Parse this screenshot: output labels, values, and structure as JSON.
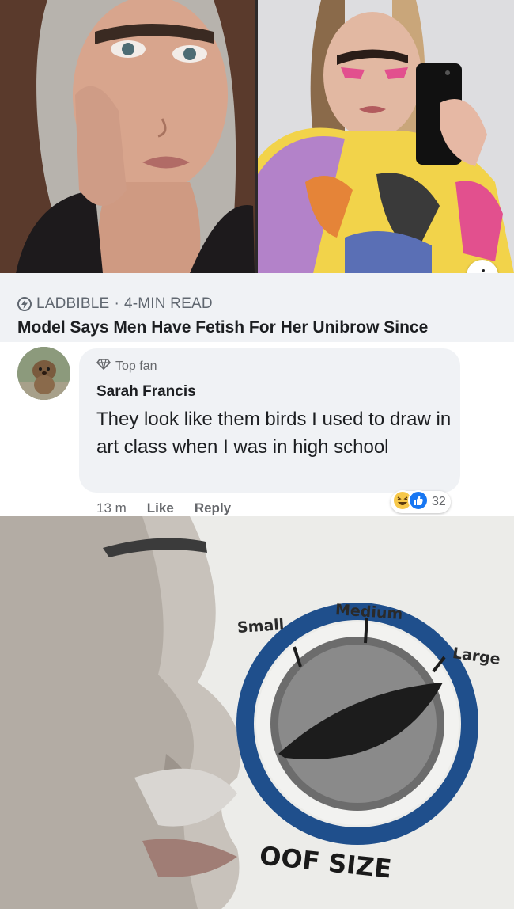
{
  "post": {
    "source": "LADBIBLE",
    "separator": "·",
    "read_time": "4-MIN READ",
    "headline": "Model Says Men Have Fetish For Her Unibrow Since",
    "info_glyph": "i"
  },
  "comment": {
    "badge": "Top fan",
    "author": "Sarah Francis",
    "text": "They look like them birds I used to draw in art class when I was in high school",
    "time": "13 m",
    "like_label": "Like",
    "reply_label": "Reply",
    "reaction_count": "32",
    "reactions": [
      "haha-icon",
      "like-icon"
    ]
  },
  "meme": {
    "small_label": "Small",
    "medium_label": "Medium",
    "large_label": "Large",
    "caption": "OOF SIZE",
    "dial_ring_color": "#1f4f8c"
  },
  "colors": {
    "link_card_bg": "#f0f2f5",
    "bubble_bg": "#f0f2f5",
    "like_blue": "#1877f2",
    "haha_yellow": "#f7c84a"
  }
}
